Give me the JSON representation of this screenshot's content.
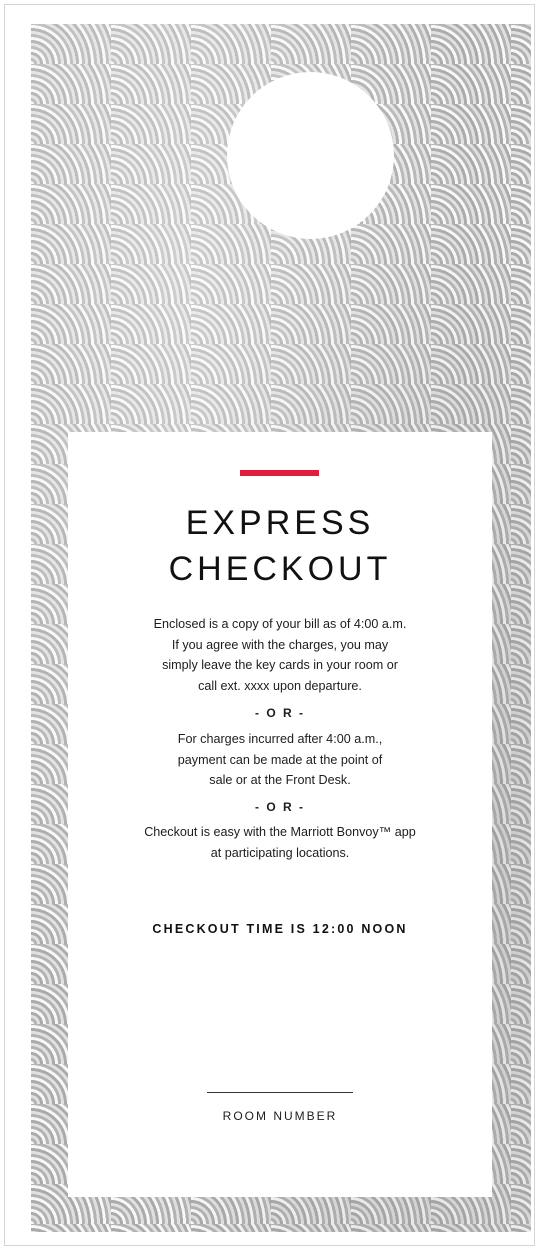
{
  "title": {
    "line1": "EXPRESS",
    "line2": "CHECKOUT"
  },
  "paragraph1": [
    "Enclosed is a copy of your bill as of 4:00 a.m.",
    "If you agree with the charges, you may",
    "simply leave the key cards in your room or",
    "call ext. xxxx upon departure."
  ],
  "separator1": "- O R -",
  "paragraph2": [
    "For charges incurred after 4:00 a.m.,",
    "payment can be made at the point of",
    "sale or at the Front Desk."
  ],
  "separator2": "- O R -",
  "paragraph3": [
    "Checkout is easy with the Marriott Bonvoy™ app",
    "at participating locations."
  ],
  "checkout_time": "CHECKOUT TIME IS 12:00 NOON",
  "room_number_label": "ROOM NUMBER",
  "colors": {
    "accent": "#e01e3c",
    "pattern": "#c9c9c9",
    "panel": "#ffffff",
    "text": "#111111"
  }
}
